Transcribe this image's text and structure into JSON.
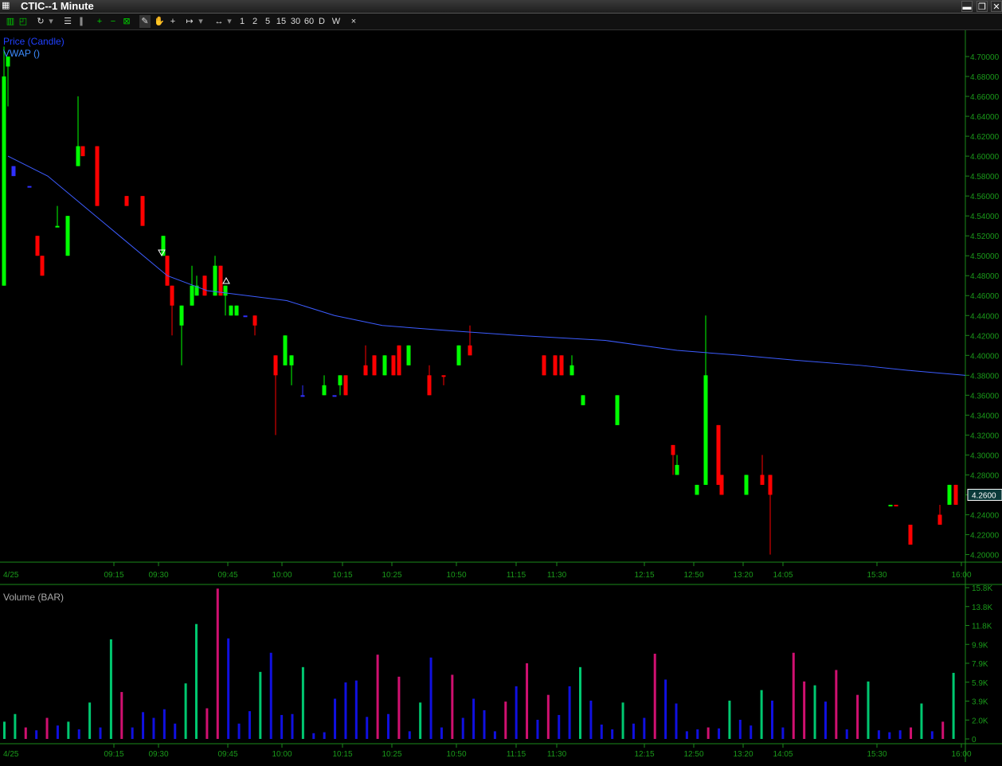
{
  "window": {
    "title": "CTIC--1 Minute",
    "icon": "chart-window-icon",
    "minimize": "▬",
    "restore": "❐",
    "close": "✕"
  },
  "toolbar": {
    "icons": [
      "bar-chart-icon",
      "line-chart-icon",
      "refresh-icon",
      "dropdown-icon",
      "list-icon",
      "pause-icon",
      "zoom-in-icon",
      "zoom-out-icon",
      "fit-icon",
      "draw-pencil-icon",
      "hand-pan-icon",
      "crosshair-icon",
      "span-icon",
      "scroll-icon"
    ],
    "intervals": [
      "1",
      "2",
      "5",
      "15",
      "30",
      "60",
      "D",
      "W"
    ],
    "close_label": "×"
  },
  "price_panel": {
    "legend_price": "Price (Candle)",
    "legend_vwap": "VWAP ()",
    "current_price": "4.2600",
    "price_ticks": [
      "4.70000",
      "4.68000",
      "4.66000",
      "4.64000",
      "4.62000",
      "4.60000",
      "4.58000",
      "4.56000",
      "4.54000",
      "4.52000",
      "4.50000",
      "4.48000",
      "4.46000",
      "4.44000",
      "4.42000",
      "4.40000",
      "4.38000",
      "4.36000",
      "4.34000",
      "4.32000",
      "4.30000",
      "4.28000",
      "4.26000",
      "4.24000",
      "4.22000",
      "4.20000"
    ],
    "date_label": "4/25",
    "time_labels": [
      "09:15",
      "09:30",
      "09:45",
      "10:00",
      "10:15",
      "10:25",
      "10:50",
      "11:15",
      "11:30",
      "12:15",
      "12:50",
      "13:20",
      "14:05",
      "15:30",
      "16:00"
    ]
  },
  "volume_panel": {
    "legend": "Volume (BAR)",
    "vol_ticks": [
      "15.8K",
      "13.8K",
      "11.8K",
      "9.9K",
      "7.9K",
      "5.9K",
      "3.9K",
      "2.0K",
      "0"
    ],
    "date_label": "4/25",
    "time_labels": [
      "09:15",
      "09:30",
      "09:45",
      "10:00",
      "10:15",
      "10:25",
      "10:50",
      "11:15",
      "11:30",
      "12:15",
      "12:50",
      "13:20",
      "14:05",
      "15:30",
      "16:00"
    ]
  },
  "colors": {
    "up": "#00ff00",
    "down": "#ff0000",
    "vwap": "#3c5cff",
    "axis": "#1a8a1a",
    "vol_up": "#00c870",
    "vol_down": "#d01070",
    "vol_flat": "#1010e0"
  },
  "chart_data": {
    "type": "candlestick",
    "title": "CTIC--1 Minute",
    "ylim": [
      4.19,
      4.72
    ],
    "candles": [
      {
        "o": 4.47,
        "h": 4.71,
        "l": 4.47,
        "c": 4.68,
        "dir": "up"
      },
      {
        "o": 4.69,
        "h": 4.7,
        "l": 4.65,
        "c": 4.7,
        "dir": "up"
      },
      {
        "o": 4.59,
        "h": 4.59,
        "l": 4.58,
        "c": 4.58,
        "dir": "flat"
      },
      {
        "o": 4.57,
        "h": 4.57,
        "l": 4.57,
        "c": 4.57,
        "dir": "flat"
      },
      {
        "o": 4.52,
        "h": 4.52,
        "l": 4.5,
        "c": 4.5,
        "dir": "down"
      },
      {
        "o": 4.5,
        "h": 4.5,
        "l": 4.48,
        "c": 4.48,
        "dir": "down"
      },
      {
        "o": 4.53,
        "h": 4.55,
        "l": 4.53,
        "c": 4.53,
        "dir": "up"
      },
      {
        "o": 4.5,
        "h": 4.54,
        "l": 4.5,
        "c": 4.54,
        "dir": "up"
      },
      {
        "o": 4.59,
        "h": 4.66,
        "l": 4.59,
        "c": 4.61,
        "dir": "up"
      },
      {
        "o": 4.61,
        "h": 4.61,
        "l": 4.6,
        "c": 4.6,
        "dir": "down"
      },
      {
        "o": 4.61,
        "h": 4.61,
        "l": 4.55,
        "c": 4.55,
        "dir": "down"
      },
      {
        "o": 4.56,
        "h": 4.56,
        "l": 4.55,
        "c": 4.55,
        "dir": "down"
      },
      {
        "o": 4.56,
        "h": 4.56,
        "l": 4.53,
        "c": 4.53,
        "dir": "down"
      },
      {
        "o": 4.5,
        "h": 4.52,
        "l": 4.5,
        "c": 4.52,
        "dir": "up"
      },
      {
        "o": 4.5,
        "h": 4.5,
        "l": 4.47,
        "c": 4.47,
        "dir": "down"
      },
      {
        "o": 4.47,
        "h": 4.47,
        "l": 4.42,
        "c": 4.45,
        "dir": "down"
      },
      {
        "o": 4.43,
        "h": 4.45,
        "l": 4.39,
        "c": 4.45,
        "dir": "up"
      },
      {
        "o": 4.45,
        "h": 4.49,
        "l": 4.45,
        "c": 4.47,
        "dir": "up"
      },
      {
        "o": 4.46,
        "h": 4.48,
        "l": 4.46,
        "c": 4.47,
        "dir": "up"
      },
      {
        "o": 4.48,
        "h": 4.48,
        "l": 4.46,
        "c": 4.46,
        "dir": "down"
      },
      {
        "o": 4.46,
        "h": 4.5,
        "l": 4.46,
        "c": 4.49,
        "dir": "up"
      },
      {
        "o": 4.49,
        "h": 4.49,
        "l": 4.46,
        "c": 4.46,
        "dir": "down"
      },
      {
        "o": 4.47,
        "h": 4.47,
        "l": 4.44,
        "c": 4.46,
        "dir": "up"
      },
      {
        "o": 4.44,
        "h": 4.45,
        "l": 4.44,
        "c": 4.45,
        "dir": "up"
      },
      {
        "o": 4.44,
        "h": 4.45,
        "l": 4.44,
        "c": 4.45,
        "dir": "up"
      },
      {
        "o": 4.44,
        "h": 4.44,
        "l": 4.44,
        "c": 4.44,
        "dir": "flat"
      },
      {
        "o": 4.44,
        "h": 4.44,
        "l": 4.42,
        "c": 4.43,
        "dir": "down"
      },
      {
        "o": 4.4,
        "h": 4.4,
        "l": 4.32,
        "c": 4.38,
        "dir": "down"
      },
      {
        "o": 4.39,
        "h": 4.42,
        "l": 4.39,
        "c": 4.42,
        "dir": "up"
      },
      {
        "o": 4.39,
        "h": 4.4,
        "l": 4.37,
        "c": 4.4,
        "dir": "up"
      },
      {
        "o": 4.36,
        "h": 4.37,
        "l": 4.36,
        "c": 4.36,
        "dir": "flat"
      },
      {
        "o": 4.36,
        "h": 4.38,
        "l": 4.36,
        "c": 4.37,
        "dir": "up"
      },
      {
        "o": 4.36,
        "h": 4.36,
        "l": 4.36,
        "c": 4.36,
        "dir": "flat"
      },
      {
        "o": 4.38,
        "h": 4.38,
        "l": 4.36,
        "c": 4.37,
        "dir": "up"
      },
      {
        "o": 4.38,
        "h": 4.38,
        "l": 4.36,
        "c": 4.36,
        "dir": "down"
      },
      {
        "o": 4.38,
        "h": 4.41,
        "l": 4.38,
        "c": 4.39,
        "dir": "down"
      },
      {
        "o": 4.38,
        "h": 4.4,
        "l": 4.38,
        "c": 4.4,
        "dir": "down"
      },
      {
        "o": 4.38,
        "h": 4.4,
        "l": 4.38,
        "c": 4.4,
        "dir": "up"
      },
      {
        "o": 4.38,
        "h": 4.4,
        "l": 4.38,
        "c": 4.4,
        "dir": "down"
      },
      {
        "o": 4.38,
        "h": 4.41,
        "l": 4.38,
        "c": 4.41,
        "dir": "down"
      },
      {
        "o": 4.39,
        "h": 4.41,
        "l": 4.39,
        "c": 4.41,
        "dir": "up"
      },
      {
        "o": 4.38,
        "h": 4.39,
        "l": 4.36,
        "c": 4.36,
        "dir": "down"
      },
      {
        "o": 4.38,
        "h": 4.38,
        "l": 4.37,
        "c": 4.38,
        "dir": "down"
      },
      {
        "o": 4.39,
        "h": 4.41,
        "l": 4.39,
        "c": 4.41,
        "dir": "up"
      },
      {
        "o": 4.41,
        "h": 4.43,
        "l": 4.4,
        "c": 4.4,
        "dir": "down"
      },
      {
        "o": 4.4,
        "h": 4.4,
        "l": 4.38,
        "c": 4.38,
        "dir": "down"
      },
      {
        "o": 4.38,
        "h": 4.4,
        "l": 4.38,
        "c": 4.4,
        "dir": "down"
      },
      {
        "o": 4.38,
        "h": 4.4,
        "l": 4.38,
        "c": 4.4,
        "dir": "down"
      },
      {
        "o": 4.38,
        "h": 4.4,
        "l": 4.38,
        "c": 4.39,
        "dir": "up"
      },
      {
        "o": 4.35,
        "h": 4.36,
        "l": 4.35,
        "c": 4.36,
        "dir": "up"
      },
      {
        "o": 4.33,
        "h": 4.36,
        "l": 4.33,
        "c": 4.36,
        "dir": "up"
      },
      {
        "o": 4.31,
        "h": 4.31,
        "l": 4.28,
        "c": 4.3,
        "dir": "down"
      },
      {
        "o": 4.28,
        "h": 4.3,
        "l": 4.28,
        "c": 4.29,
        "dir": "up"
      },
      {
        "o": 4.26,
        "h": 4.27,
        "l": 4.26,
        "c": 4.27,
        "dir": "up"
      },
      {
        "o": 4.27,
        "h": 4.44,
        "l": 4.27,
        "c": 4.38,
        "dir": "up"
      },
      {
        "o": 4.33,
        "h": 4.33,
        "l": 4.27,
        "c": 4.27,
        "dir": "down"
      },
      {
        "o": 4.28,
        "h": 4.28,
        "l": 4.26,
        "c": 4.26,
        "dir": "down"
      },
      {
        "o": 4.26,
        "h": 4.28,
        "l": 4.26,
        "c": 4.28,
        "dir": "up"
      },
      {
        "o": 4.28,
        "h": 4.3,
        "l": 4.27,
        "c": 4.27,
        "dir": "down"
      },
      {
        "o": 4.28,
        "h": 4.28,
        "l": 4.2,
        "c": 4.26,
        "dir": "down"
      },
      {
        "o": 4.25,
        "h": 4.25,
        "l": 4.25,
        "c": 4.25,
        "dir": "up"
      },
      {
        "o": 4.25,
        "h": 4.25,
        "l": 4.25,
        "c": 4.25,
        "dir": "down"
      },
      {
        "o": 4.23,
        "h": 4.23,
        "l": 4.21,
        "c": 4.21,
        "dir": "down"
      },
      {
        "o": 4.24,
        "h": 4.25,
        "l": 4.23,
        "c": 4.23,
        "dir": "down"
      },
      {
        "o": 4.25,
        "h": 4.27,
        "l": 4.25,
        "c": 4.27,
        "dir": "up"
      },
      {
        "o": 4.27,
        "h": 4.27,
        "l": 4.25,
        "c": 4.25,
        "dir": "down"
      }
    ],
    "vwap": [
      4.6,
      4.58,
      4.52,
      4.48,
      4.465,
      4.46,
      4.455,
      4.44,
      4.43,
      4.425,
      4.42,
      4.415,
      4.405,
      4.4,
      4.395,
      4.39,
      4.385,
      4.38
    ],
    "volume_ylim": [
      0,
      15800
    ],
    "volumes": [
      1800,
      2600,
      1200,
      900,
      2200,
      1400,
      1800,
      1000,
      3800,
      1200,
      10400,
      4900,
      1200,
      2800,
      2200,
      3100,
      1600,
      5800,
      12000,
      3200,
      15700,
      10500,
      1600,
      2900,
      7000,
      9000,
      2500,
      2600,
      7500,
      600,
      700,
      4200,
      5900,
      6100,
      2300,
      8800,
      2600,
      6500,
      800,
      3800,
      8500,
      1200,
      6700,
      2200,
      4200,
      3000,
      800,
      3900,
      5500,
      7900,
      2000,
      4600,
      2500,
      5500,
      7500,
      4000,
      1500,
      1000,
      3800,
      1600,
      2200,
      8900,
      6200,
      3700,
      800,
      1000,
      1200,
      1100,
      4000,
      2000,
      1400,
      5100,
      4000,
      1200,
      9000,
      6000,
      5600,
      3900,
      7200,
      1000,
      4600,
      6000,
      900,
      700,
      900,
      1200,
      3700,
      800,
      1800,
      6900
    ],
    "vol_dir": [
      "up",
      "up",
      "down",
      "flat",
      "down",
      "flat",
      "up",
      "flat",
      "up",
      "flat",
      "up",
      "down",
      "flat",
      "flat",
      "flat",
      "flat",
      "flat",
      "up",
      "up",
      "down",
      "down",
      "flat",
      "flat",
      "flat",
      "up",
      "flat",
      "flat",
      "flat",
      "up",
      "flat",
      "flat",
      "flat",
      "flat",
      "flat",
      "flat",
      "down",
      "flat",
      "down",
      "flat",
      "up",
      "flat",
      "flat",
      "down",
      "flat",
      "flat",
      "flat",
      "flat",
      "down",
      "flat",
      "down",
      "flat",
      "down",
      "flat",
      "flat",
      "up",
      "flat",
      "flat",
      "flat",
      "up",
      "flat",
      "flat",
      "down",
      "flat",
      "flat",
      "flat",
      "flat",
      "down",
      "flat",
      "up",
      "flat",
      "flat",
      "up",
      "flat",
      "flat",
      "down",
      "down",
      "up",
      "flat",
      "down",
      "flat",
      "down",
      "up",
      "flat",
      "flat",
      "flat",
      "down",
      "up",
      "flat",
      "down",
      "up"
    ]
  }
}
